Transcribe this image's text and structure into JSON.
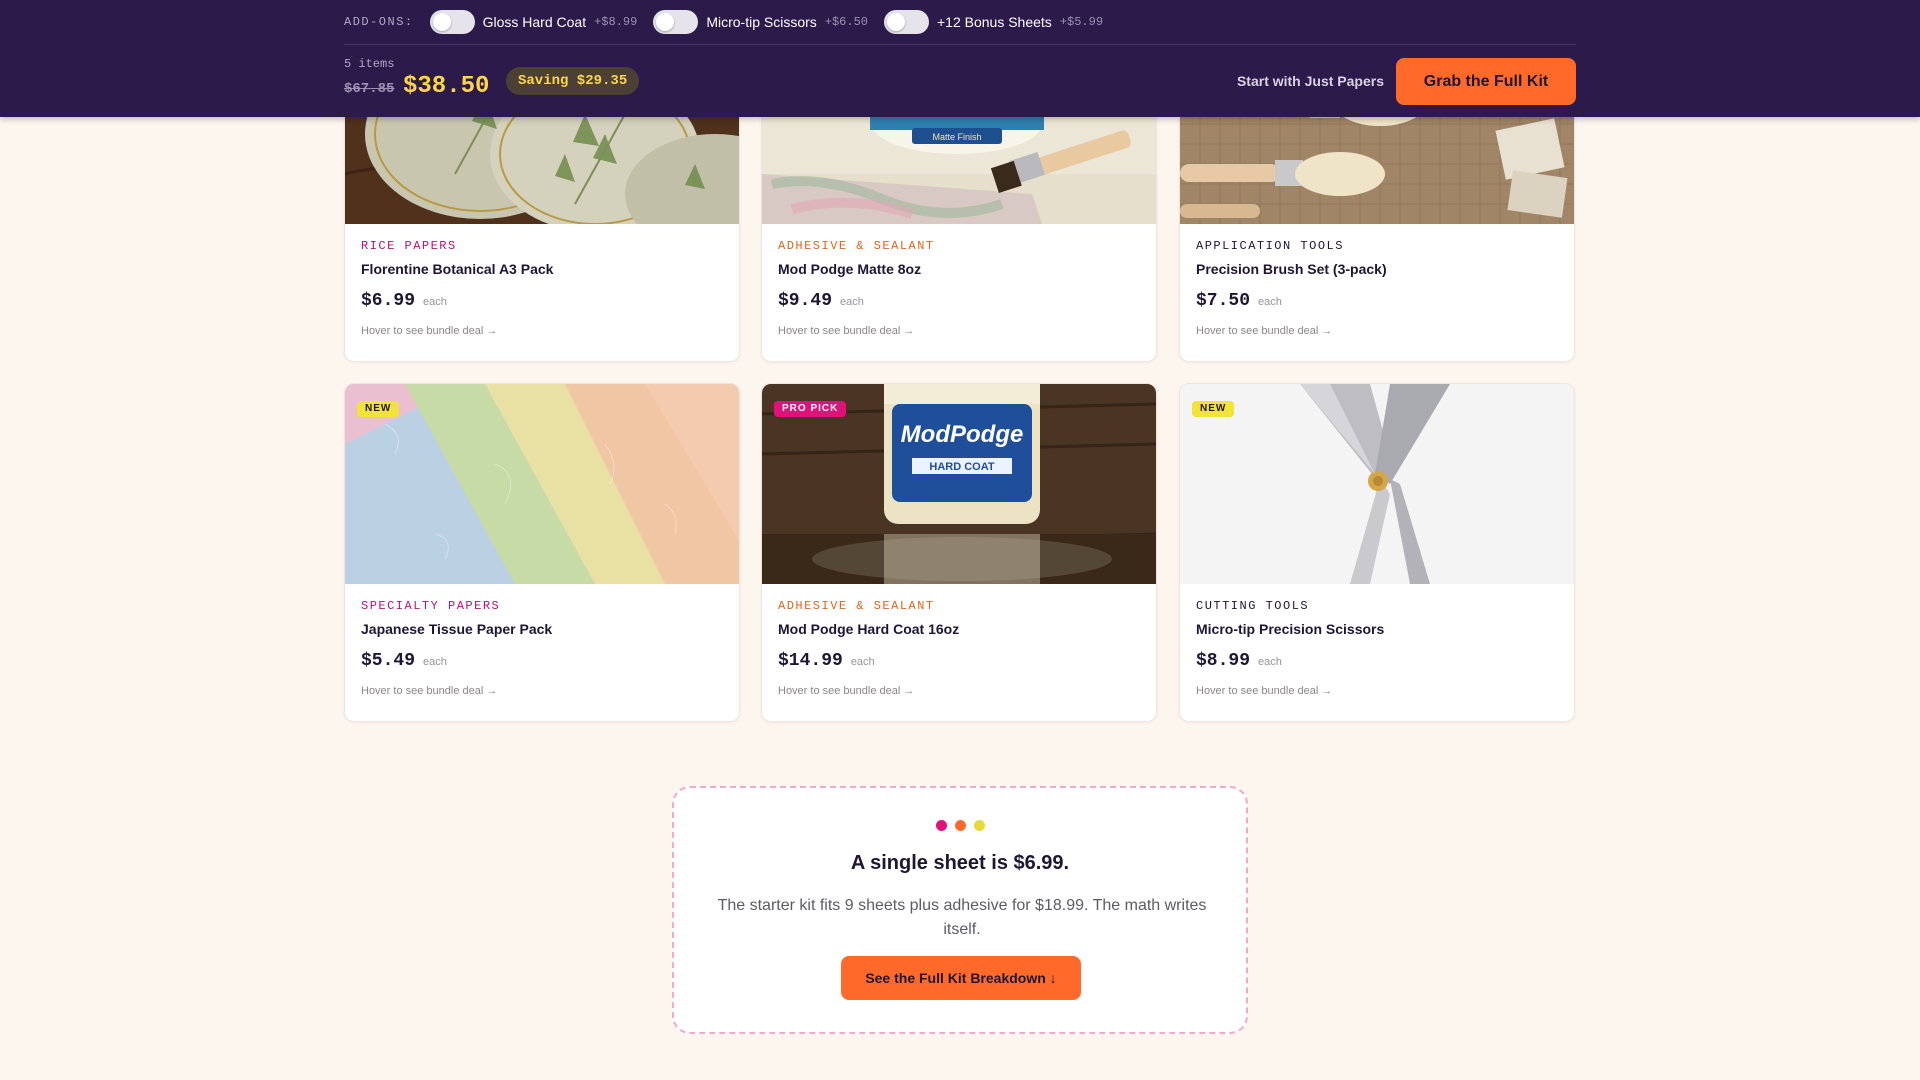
{
  "header": {
    "addons_label": "ADD-ONS:",
    "addons": [
      {
        "name": "Gloss Hard Coat",
        "price": "+$8.99",
        "enabled": false
      },
      {
        "name": "Micro-tip Scissors",
        "price": "+$6.50",
        "enabled": false
      },
      {
        "name": "+12 Bonus Sheets",
        "price": "+$5.99",
        "enabled": false
      }
    ],
    "items_count": "5 items",
    "old_total": "$67.85",
    "new_total": "$38.50",
    "saving": "Saving $29.35",
    "secondary_action": "Start with Just Papers",
    "primary_action": "Grab the Full Kit"
  },
  "products": [
    {
      "category": "RICE PAPERS",
      "category_color": "#b5127a",
      "name": "Florentine Botanical A3 Pack",
      "price": "$6.99",
      "unit": "each",
      "hint": "Hover to see bundle deal →",
      "image": "botanical-coasters"
    },
    {
      "category": "ADHESIVE & SEALANT",
      "category_color": "#e0631c",
      "name": "Mod Podge Matte 8oz",
      "price": "$9.49",
      "unit": "each",
      "hint": "Hover to see bundle deal →",
      "image": "mod-podge-matte-jar"
    },
    {
      "category": "APPLICATION TOOLS",
      "category_color": "#1f1633",
      "name": "Precision Brush Set (3-pack)",
      "price": "$7.50",
      "unit": "each",
      "hint": "Hover to see bundle deal →",
      "image": "brushes-on-burlap"
    },
    {
      "category": "SPECIALTY PAPERS",
      "category_color": "#b5127a",
      "name": "Japanese Tissue Paper Pack",
      "price": "$5.49",
      "unit": "each",
      "hint": "Hover to see bundle deal →",
      "badge": "NEW",
      "badge_bg": "#f2e33a",
      "badge_color": "#1f1633",
      "image": "pastel-tissue-sheets"
    },
    {
      "category": "ADHESIVE & SEALANT",
      "category_color": "#e0631c",
      "name": "Mod Podge Hard Coat 16oz",
      "price": "$14.99",
      "unit": "each",
      "hint": "Hover to see bundle deal →",
      "badge": "PRO PICK",
      "badge_bg": "#e0127a",
      "badge_color": "#ffffff",
      "image": "mod-podge-hard-coat-jar",
      "jar_brand": "ModPodge",
      "jar_label": "HARD COAT"
    },
    {
      "category": "CUTTING TOOLS",
      "category_color": "#1f1633",
      "name": "Micro-tip Precision Scissors",
      "price": "$8.99",
      "unit": "each",
      "hint": "Hover to see bundle deal →",
      "badge": "NEW",
      "badge_bg": "#f2e33a",
      "badge_color": "#1f1633",
      "image": "silver-scissors"
    }
  ],
  "cta": {
    "dots": [
      "#e0127a",
      "#ff6a2b",
      "#e8d93a"
    ],
    "title": "A single sheet is $6.99.",
    "text": "The starter kit fits 9 sheets plus adhesive for $18.99. The math writes itself.",
    "button": "See the Full Kit Breakdown ↓"
  }
}
